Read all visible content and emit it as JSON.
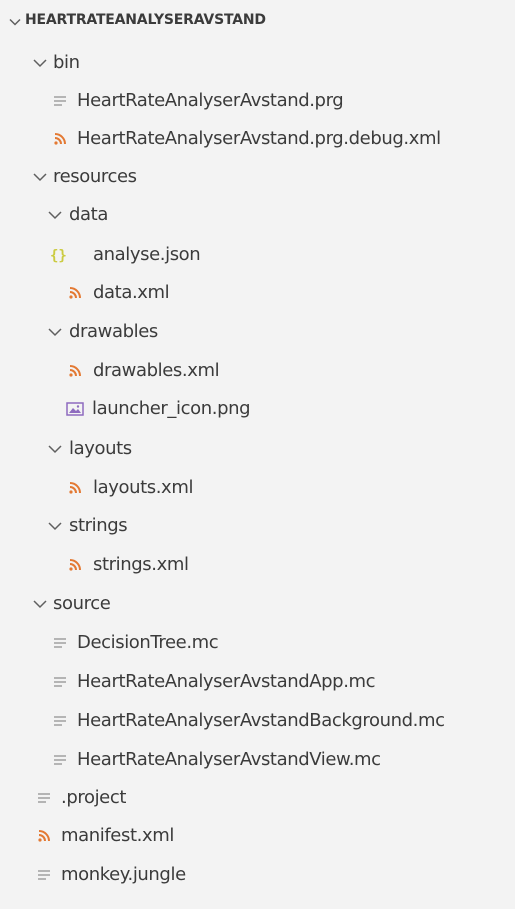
{
  "explorer": {
    "root_title": "HEARTRATEANALYSERAVSTAND",
    "colors": {
      "text": "#3b3b3b",
      "chevron": "#5f5f5f",
      "lines_icon": "#9a9a9a",
      "rss_icon": "#e37933",
      "json_icon": "#cbcb41",
      "image_icon": "#8e6bbf",
      "background": "#f3f3f3"
    },
    "items": [
      {
        "label": "bin",
        "kind": "folder",
        "icon": "chevron-down-icon"
      },
      {
        "label": "HeartRateAnalyserAvstand.prg",
        "kind": "file",
        "icon": "lines-file-icon"
      },
      {
        "label": "HeartRateAnalyserAvstand.prg.debug.xml",
        "kind": "file",
        "icon": "xml-rss-icon"
      },
      {
        "label": "resources",
        "kind": "folder",
        "icon": "chevron-down-icon"
      },
      {
        "label": "data",
        "kind": "folder",
        "icon": "chevron-down-icon"
      },
      {
        "label": "analyse.json",
        "kind": "file",
        "icon": "json-braces-icon"
      },
      {
        "label": "data.xml",
        "kind": "file",
        "icon": "xml-rss-icon"
      },
      {
        "label": "drawables",
        "kind": "folder",
        "icon": "chevron-down-icon"
      },
      {
        "label": "drawables.xml",
        "kind": "file",
        "icon": "xml-rss-icon"
      },
      {
        "label": "launcher_icon.png",
        "kind": "file",
        "icon": "image-file-icon"
      },
      {
        "label": "layouts",
        "kind": "folder",
        "icon": "chevron-down-icon"
      },
      {
        "label": "layouts.xml",
        "kind": "file",
        "icon": "xml-rss-icon"
      },
      {
        "label": "strings",
        "kind": "folder",
        "icon": "chevron-down-icon"
      },
      {
        "label": "strings.xml",
        "kind": "file",
        "icon": "xml-rss-icon"
      },
      {
        "label": "source",
        "kind": "folder",
        "icon": "chevron-down-icon"
      },
      {
        "label": "DecisionTree.mc",
        "kind": "file",
        "icon": "lines-file-icon"
      },
      {
        "label": "HeartRateAnalyserAvstandApp.mc",
        "kind": "file",
        "icon": "lines-file-icon"
      },
      {
        "label": "HeartRateAnalyserAvstandBackground.mc",
        "kind": "file",
        "icon": "lines-file-icon"
      },
      {
        "label": "HeartRateAnalyserAvstandView.mc",
        "kind": "file",
        "icon": "lines-file-icon"
      },
      {
        "label": ".project",
        "kind": "file",
        "icon": "lines-file-icon"
      },
      {
        "label": "manifest.xml",
        "kind": "file",
        "icon": "xml-rss-icon"
      },
      {
        "label": "monkey.jungle",
        "kind": "file",
        "icon": "lines-file-icon"
      }
    ]
  }
}
